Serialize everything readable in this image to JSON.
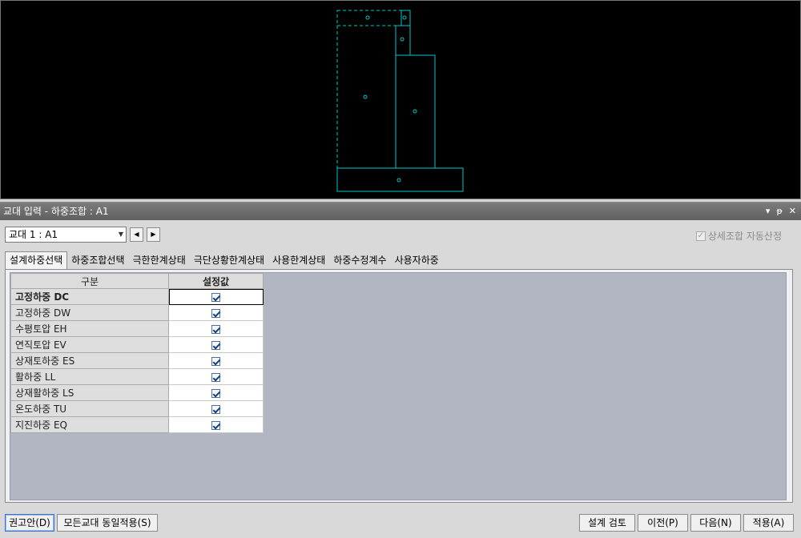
{
  "panel": {
    "title": "교대 입력 - 하중조합 : A1",
    "controls": [
      "▾",
      "ᵽ",
      "✕"
    ]
  },
  "bridge": {
    "selected": "교대 1 : A1",
    "prev": "◀",
    "next": "▶"
  },
  "auto_option": {
    "label": "상세조합 자동산정",
    "checked": true
  },
  "tabs": [
    {
      "label": "설계하중선택",
      "active": true
    },
    {
      "label": "하중조합선택",
      "active": false
    },
    {
      "label": "극한한계상태",
      "active": false
    },
    {
      "label": "극단상황한계상태",
      "active": false
    },
    {
      "label": "사용한계상태",
      "active": false
    },
    {
      "label": "하중수정계수",
      "active": false
    },
    {
      "label": "사용자하중",
      "active": false
    }
  ],
  "grid": {
    "columns": [
      "구분",
      "설정값"
    ],
    "rows": [
      {
        "name": "고정하중 DC",
        "checked": true,
        "bold": true
      },
      {
        "name": "고정하중 DW",
        "checked": true
      },
      {
        "name": "수평토압 EH",
        "checked": true
      },
      {
        "name": "연직토압 EV",
        "checked": true
      },
      {
        "name": "상재토하중 ES",
        "checked": true
      },
      {
        "name": "활하중 LL",
        "checked": true
      },
      {
        "name": "상재활하중 LS",
        "checked": true
      },
      {
        "name": "온도하중 TU",
        "checked": true
      },
      {
        "name": "지진하중 EQ",
        "checked": true
      }
    ]
  },
  "buttons": {
    "recommend": "권고안(D)",
    "apply_all": "모든교대 동일적용(S)",
    "review": "설계 검토",
    "prev": "이전(P)",
    "next": "다음(N)",
    "apply": "적용(A)"
  },
  "colors": {
    "canvas_bg": "#000000",
    "drawing_line": "#00c8c8",
    "grid_bg": "#b2b5c2"
  }
}
